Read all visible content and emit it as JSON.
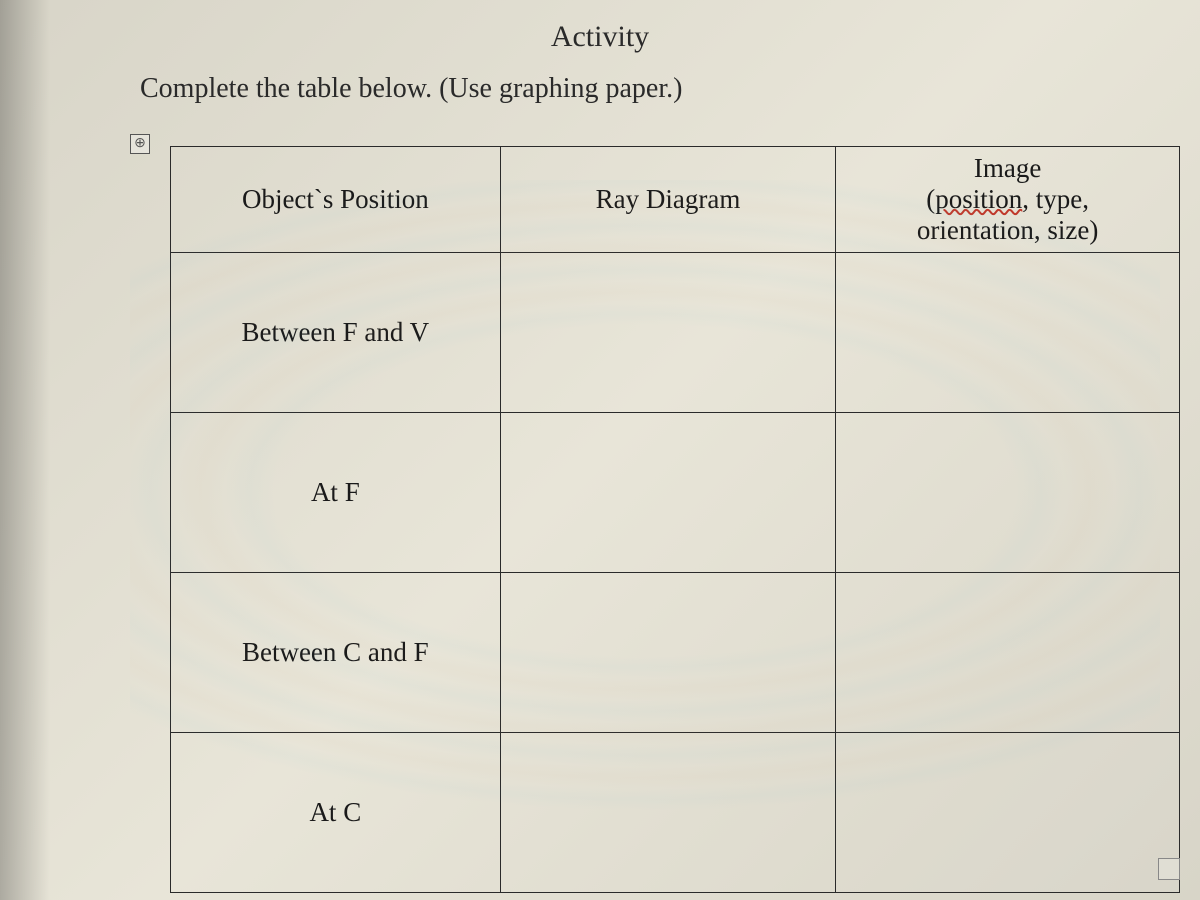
{
  "page": {
    "title": "Activity",
    "instruction": "Complete the table below. (Use graphing paper.)",
    "anchor_glyph": "⊕"
  },
  "table": {
    "headers": {
      "object_position": "Object`s Position",
      "ray_diagram": "Ray Diagram",
      "image_line1": "Image",
      "image_line2_pre": "(",
      "image_line2_word": "position",
      "image_line2_post": ", type,",
      "image_line3": "orientation, size)"
    },
    "rows": [
      {
        "object_position": "Between F and V",
        "ray_diagram": "",
        "image": ""
      },
      {
        "object_position": "At F",
        "ray_diagram": "",
        "image": ""
      },
      {
        "object_position": "Between C and F",
        "ray_diagram": "",
        "image": ""
      },
      {
        "object_position": "At C",
        "ray_diagram": "",
        "image": ""
      }
    ]
  }
}
